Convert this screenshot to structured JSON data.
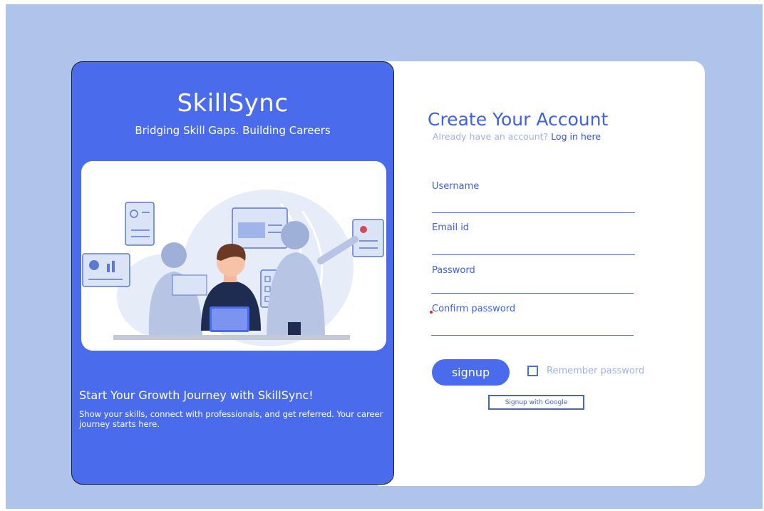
{
  "brand": {
    "name": "SkillSync",
    "tagline": "Bridging Skill Gaps. Building Careers"
  },
  "journey": {
    "title": "Start Your Growth Journey with SkillSync!",
    "description": "Show your skills, connect with professionals, and get referred. Your career journey starts here."
  },
  "form": {
    "title": "Create Your Account",
    "login_prompt": "Already have an account?",
    "login_link": "Log in here",
    "fields": [
      {
        "label": "Username",
        "value": ""
      },
      {
        "label": "Email id",
        "value": ""
      },
      {
        "label": "Password",
        "value": ""
      },
      {
        "label": "Confirm password",
        "value": ""
      }
    ],
    "signup_label": "signup",
    "remember_label": "Remember password",
    "google_label": "Signup with Google"
  },
  "colors": {
    "primary": "#4a6cec",
    "background": "#aec4ea",
    "muted_text": "#9fb0e6"
  }
}
